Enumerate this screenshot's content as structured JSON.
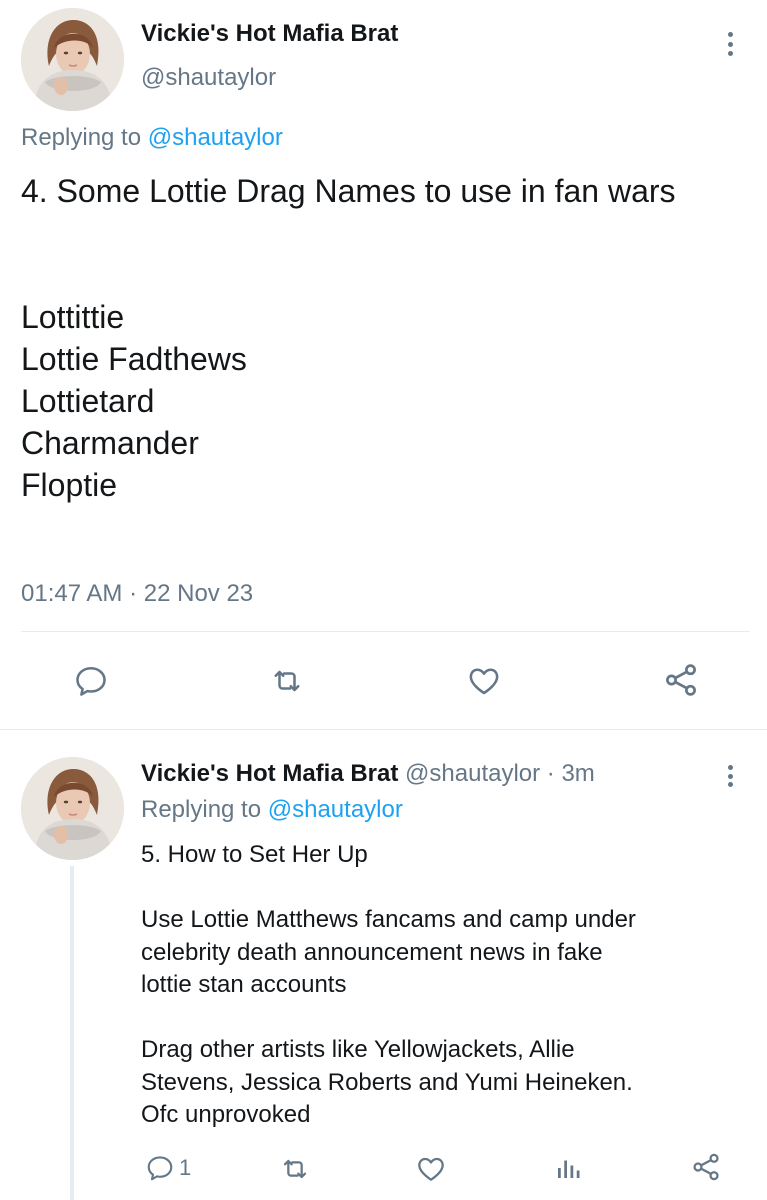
{
  "tweet_main": {
    "display_name": "Vickie's Hot Mafia Brat",
    "handle": "@shautaylor",
    "replying_prefix": "Replying to",
    "replying_handle": "@shautaylor",
    "text_lines": [
      "4. Some Lottie Drag Names to use in fan wars",
      "",
      "",
      "Lottittie",
      "Lottie Fadthews",
      "Lottietard",
      "Charmander",
      "Floptie"
    ],
    "time": "01:47 AM",
    "separator": "·",
    "date": "22 Nov 23",
    "icons": [
      "comment-icon",
      "retweet-icon",
      "heart-icon",
      "share-icon"
    ]
  },
  "tweet_reply": {
    "display_name": "Vickie's Hot Mafia Brat",
    "handle": "@shautaylor",
    "time_ago": "· 3m",
    "replying_prefix": "Replying to",
    "replying_handle": "@shautaylor",
    "text_lines": [
      "5. How to Set Her Up",
      "",
      "Use Lottie Matthews fancams and camp under",
      "celebrity death announcement news in fake",
      "lottie stan accounts",
      "",
      "Drag other artists like Yellowjackets, Allie",
      "Stevens, Jessica Roberts and Yumi Heineken.",
      "Ofc unprovoked"
    ],
    "reply_count": "1",
    "icons": [
      "comment-icon",
      "retweet-icon",
      "heart-icon",
      "analytics-icon",
      "share-icon"
    ]
  },
  "colors": {
    "text": "#14171a",
    "muted": "#657786",
    "link": "#1da1f2",
    "divider": "#e6ecf0"
  }
}
